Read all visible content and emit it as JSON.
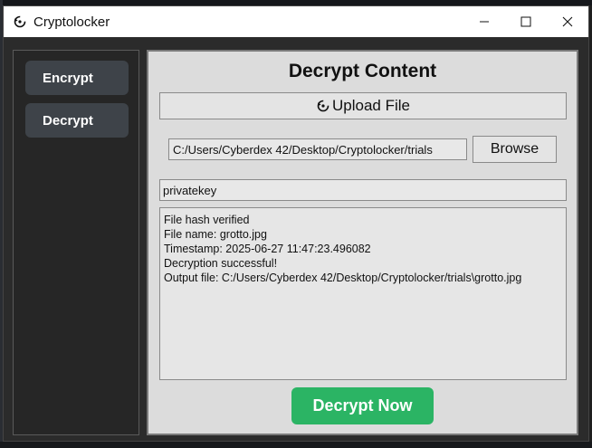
{
  "window": {
    "title": "Cryptolocker",
    "icon": "recycle-arrow-icon"
  },
  "controls": {
    "minimize": "minimize-icon",
    "maximize": "maximize-icon",
    "close": "close-icon"
  },
  "sidebar": {
    "items": [
      {
        "label": "Encrypt"
      },
      {
        "label": "Decrypt"
      }
    ]
  },
  "panel": {
    "title": "Decrypt Content",
    "upload_label": "Upload File",
    "file_path_value": "C:/Users/Cyberdex 42/Desktop/Cryptolocker/trials",
    "browse_label": "Browse",
    "key_value": "privatekey",
    "log_lines": [
      "File hash verified",
      "File name: grotto.jpg",
      "Timestamp: 2025-06-27 11:47:23.496082",
      "Decryption successful!",
      "Output file: C:/Users/Cyberdex 42/Desktop/Cryptolocker/trials\\grotto.jpg"
    ],
    "action_label": "Decrypt Now"
  },
  "colors": {
    "accent_green": "#2bb464",
    "sidebar_button": "#3e4349",
    "panel_bg": "#dcdcdc"
  }
}
